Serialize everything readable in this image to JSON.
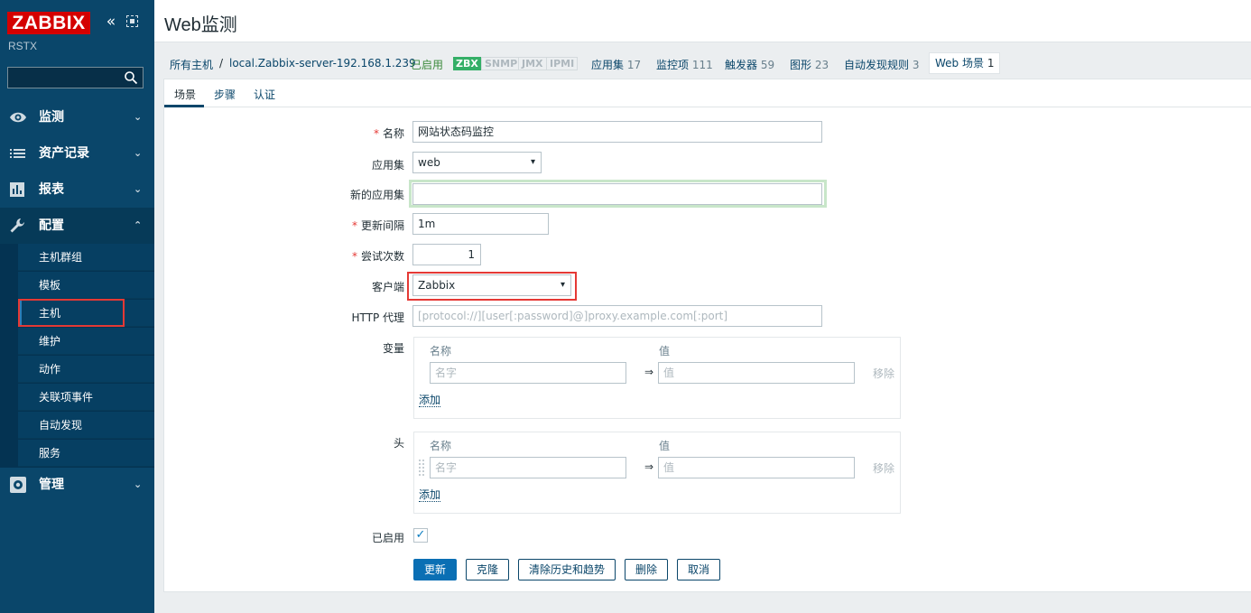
{
  "brand": {
    "logo": "ZABBIX",
    "server": "RSTX"
  },
  "sidebar": {
    "menu": [
      {
        "label": "监测",
        "icon": "eye-icon",
        "open": false
      },
      {
        "label": "资产记录",
        "icon": "list-icon",
        "open": false
      },
      {
        "label": "报表",
        "icon": "bar-chart-icon",
        "open": false
      },
      {
        "label": "配置",
        "icon": "wrench-icon",
        "open": true
      },
      {
        "label": "管理",
        "icon": "gear-icon",
        "open": false
      }
    ],
    "submenu": [
      "主机群组",
      "模板",
      "主机",
      "维护",
      "动作",
      "关联项事件",
      "自动发现",
      "服务"
    ],
    "active_submenu": "主机"
  },
  "header": {
    "title": "Web监测"
  },
  "breadcrumbs": {
    "all_hosts": "所有主机",
    "separator": "/",
    "host": "local.Zabbix-server-192.168.1.239",
    "status": "已启用",
    "availability": [
      "ZBX",
      "SNMP",
      "JMX",
      "IPMI"
    ],
    "applications": {
      "label": "应用集",
      "count": "17"
    },
    "items": {
      "label": "监控项",
      "count": "111"
    },
    "triggers": {
      "label": "触发器",
      "count": "59"
    },
    "graphs": {
      "label": "图形",
      "count": "23"
    },
    "discovery": {
      "label": "自动发现规则",
      "count": "3"
    },
    "web": {
      "label": "Web 场景",
      "count": "1"
    }
  },
  "tabs": [
    "场景",
    "步骤",
    "认证"
  ],
  "form": {
    "name": {
      "label": "名称",
      "value": "网站状态码监控"
    },
    "application": {
      "label": "应用集",
      "value": "web"
    },
    "new_application": {
      "label": "新的应用集",
      "value": ""
    },
    "update_interval": {
      "label": "更新间隔",
      "value": "1m"
    },
    "attempts": {
      "label": "尝试次数",
      "value": "1"
    },
    "agent": {
      "label": "客户端",
      "value": "Zabbix"
    },
    "http_proxy": {
      "label": "HTTP 代理",
      "placeholder": "[protocol://][user[:password]@]proxy.example.com[:port]"
    },
    "variables": {
      "label": "变量",
      "col_name": "名称",
      "col_value": "值",
      "name_placeholder": "名字",
      "value_placeholder": "值",
      "arrow": "⇒",
      "remove": "移除",
      "add": "添加"
    },
    "headers": {
      "label": "头",
      "col_name": "名称",
      "col_value": "值",
      "name_placeholder": "名字",
      "value_placeholder": "值",
      "arrow": "⇒",
      "remove": "移除",
      "add": "添加"
    },
    "enabled": {
      "label": "已启用",
      "checked": true
    }
  },
  "buttons": {
    "update": "更新",
    "clone": "克隆",
    "clear_history": "清除历史和趋势",
    "delete": "删除",
    "cancel": "取消"
  },
  "colors": {
    "sidebar": "#0a466a",
    "logo": "#d40000",
    "highlight": "#e53935",
    "primary": "#0a6fb4"
  }
}
